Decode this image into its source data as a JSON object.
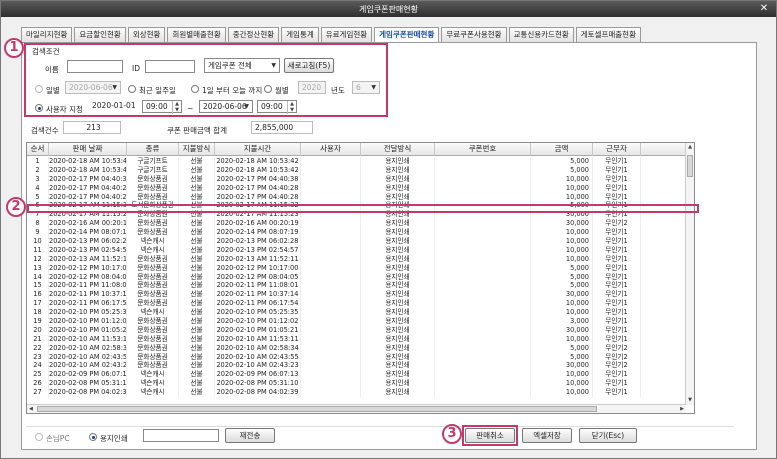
{
  "window": {
    "title": "게임쿠폰판매현황",
    "close": "✕"
  },
  "tabs": [
    "마일리지현황",
    "요금할인현황",
    "외상현황",
    "회원별매출현황",
    "중간정산현황",
    "게임통계",
    "유료게임현황",
    "게임쿠폰판매현황",
    "무료쿠폰사용현황",
    "교통신용카드현황",
    "게토셀프매출현황"
  ],
  "active_tab_index": 7,
  "search": {
    "section_label": "검색조건",
    "name_label": "이름",
    "id_label": "ID",
    "coupon_select": "게임쿠폰 전체",
    "refresh_button": "새로고침(F5)",
    "daily_label": "일별",
    "daily_date": "2020-06-06",
    "recent_week_label": "최근 일주일",
    "month_to_today_label": "1일 부터 오늘 까지",
    "monthly_label": "월별",
    "monthly_year": "2020",
    "year_label": "년도",
    "monthly_month": "6",
    "user_range_label": "사용자 지정",
    "from_date": "2020-01-01",
    "from_time": "09:00",
    "range_sep": "~",
    "to_date": "2020-06-06",
    "to_time": "09:00",
    "selected_mode": "user_range"
  },
  "summary": {
    "count_label": "검색건수",
    "count_value": "213",
    "total_label": "쿠폰 판매금액 합계",
    "total_value": "2,855,000"
  },
  "table": {
    "columns": [
      "순서",
      "판매 날짜",
      "종류",
      "지불방식",
      "지불시간",
      "사용자",
      "전달방식",
      "쿠폰번호",
      "금액",
      "근무자"
    ],
    "rows": [
      [
        "1",
        "2020-02-18 AM 10:53:42",
        "구글기프트",
        "선불",
        "2020-02-18 AM 10:53:42",
        "",
        "용지인쇄",
        "",
        "5,000",
        "무인기1"
      ],
      [
        "2",
        "2020-02-18 AM 10:53:42",
        "구글기프트",
        "선불",
        "2020-02-18 AM 10:53:42",
        "",
        "용지인쇄",
        "",
        "5,000",
        "무인기1"
      ],
      [
        "3",
        "2020-02-17 PM 04:40:38",
        "문화상품권",
        "선불",
        "2020-02-17 PM 04:40:38",
        "",
        "용지인쇄",
        "",
        "10,000",
        "무인기1"
      ],
      [
        "4",
        "2020-02-17 PM 04:40:28",
        "문화상품권",
        "선불",
        "2020-02-17 PM 04:40:28",
        "",
        "용지인쇄",
        "",
        "10,000",
        "무인기1"
      ],
      [
        "5",
        "2020-02-17 PM 04:40:28",
        "문화상품권",
        "선불",
        "2020-02-17 PM 04:40:28",
        "",
        "용지인쇄",
        "",
        "10,000",
        "무인기1"
      ],
      [
        "6",
        "2020-02-17 AM 11:15:32",
        "도서문화상품권",
        "선불",
        "2020-02-17 AM 11:15:32",
        "",
        "용지인쇄",
        "",
        "5,000",
        "무인기1"
      ],
      [
        "7",
        "2020-02-17 AM 11:15:23",
        "문화상품권",
        "선불",
        "2020-02-17 AM 11:15:23",
        "",
        "용지인쇄",
        "",
        "30,000",
        "무인기1"
      ],
      [
        "8",
        "2020-02-16 AM 00:20:19",
        "문화상품권",
        "선불",
        "2020-02-16 AM 00:20:19",
        "",
        "용지인쇄",
        "",
        "30,000",
        "무인기2"
      ],
      [
        "9",
        "2020-02-14 PM 08:07:19",
        "문화상품권",
        "선불",
        "2020-02-14 PM 08:07:19",
        "",
        "용지인쇄",
        "",
        "10,000",
        "무인기1"
      ],
      [
        "10",
        "2020-02-13 PM 06:02:28",
        "넥슨캐시",
        "선불",
        "2020-02-13 PM 06:02:28",
        "",
        "용지인쇄",
        "",
        "10,000",
        "무인기1"
      ],
      [
        "11",
        "2020-02-13 PM 02:54:57",
        "넥슨캐시",
        "선불",
        "2020-02-13 PM 02:54:57",
        "",
        "용지인쇄",
        "",
        "10,000",
        "무인기1"
      ],
      [
        "12",
        "2020-02-13 AM 11:52:11",
        "문화상품권",
        "선불",
        "2020-02-13 AM 11:52:11",
        "",
        "용지인쇄",
        "",
        "10,000",
        "무인기1"
      ],
      [
        "13",
        "2020-02-12 PM 10:17:00",
        "문화상품권",
        "선불",
        "2020-02-12 PM 10:17:00",
        "",
        "용지인쇄",
        "",
        "5,000",
        "무인기1"
      ],
      [
        "14",
        "2020-02-12 PM 08:04:05",
        "문화상품권",
        "선불",
        "2020-02-12 PM 08:04:05",
        "",
        "용지인쇄",
        "",
        "5,000",
        "무인기1"
      ],
      [
        "15",
        "2020-02-11 PM 11:08:01",
        "문화상품권",
        "선불",
        "2020-02-11 PM 11:08:01",
        "",
        "용지인쇄",
        "",
        "5,000",
        "무인기1"
      ],
      [
        "16",
        "2020-02-11 PM 10:37:14",
        "문화상품권",
        "선불",
        "2020-02-11 PM 10:37:14",
        "",
        "용지인쇄",
        "",
        "30,000",
        "무인기1"
      ],
      [
        "17",
        "2020-02-11 PM 06:17:54",
        "문화상품권",
        "선불",
        "2020-02-11 PM 06:17:54",
        "",
        "용지인쇄",
        "",
        "10,000",
        "무인기1"
      ],
      [
        "18",
        "2020-02-10 PM 05:25:35",
        "넥슨캐시",
        "선불",
        "2020-02-10 PM 05:25:35",
        "",
        "용지인쇄",
        "",
        "10,000",
        "무인기1"
      ],
      [
        "19",
        "2020-02-10 PM 01:12:02",
        "문화상품권",
        "선불",
        "2020-02-10 PM 01:12:02",
        "",
        "용지인쇄",
        "",
        "3,000",
        "무인기1"
      ],
      [
        "20",
        "2020-02-10 PM 01:05:21",
        "문화상품권",
        "선불",
        "2020-02-10 PM 01:05:21",
        "",
        "용지인쇄",
        "",
        "30,000",
        "무인기1"
      ],
      [
        "21",
        "2020-02-10 AM 11:53:11",
        "문화상품권",
        "선불",
        "2020-02-10 AM 11:53:11",
        "",
        "용지인쇄",
        "",
        "10,000",
        "무인기1"
      ],
      [
        "22",
        "2020-02-10 AM 02:58:34",
        "문화상품권",
        "선불",
        "2020-02-10 AM 02:58:34",
        "",
        "용지인쇄",
        "",
        "5,000",
        "무인기2"
      ],
      [
        "23",
        "2020-02-10 AM 02:43:55",
        "문화상품권",
        "선불",
        "2020-02-10 AM 02:43:55",
        "",
        "용지인쇄",
        "",
        "5,000",
        "무인기2"
      ],
      [
        "24",
        "2020-02-10 AM 02:43:23",
        "문화상품권",
        "선불",
        "2020-02-10 AM 02:43:23",
        "",
        "용지인쇄",
        "",
        "30,000",
        "무인기2"
      ],
      [
        "25",
        "2020-02-09 PM 06:07:13",
        "넥슨캐시",
        "선불",
        "2020-02-09 PM 06:07:13",
        "",
        "용지인쇄",
        "",
        "10,000",
        "무인기1"
      ],
      [
        "26",
        "2020-02-08 PM 05:31:10",
        "넥슨캐시",
        "선불",
        "2020-02-08 PM 05:31:10",
        "",
        "용지인쇄",
        "",
        "10,000",
        "무인기1"
      ],
      [
        "27",
        "2020-02-08 PM 04:02:39",
        "넥슨캐시",
        "선불",
        "2020-02-08 PM 04:02:39",
        "",
        "용지인쇄",
        "",
        "10,000",
        "무인기1"
      ]
    ]
  },
  "bottom": {
    "pc_radio": "손님PC",
    "paper_radio": "용지인쇄",
    "reissue_button": "재전송",
    "cancel_sale_button": "판매취소",
    "excel_button": "엑셀저장",
    "close_button": "닫기(Esc)"
  },
  "annotations": [
    "1",
    "2",
    "3"
  ],
  "colors": {
    "annotation": "#c23a6b",
    "active_tab": "#1a4fa0"
  }
}
